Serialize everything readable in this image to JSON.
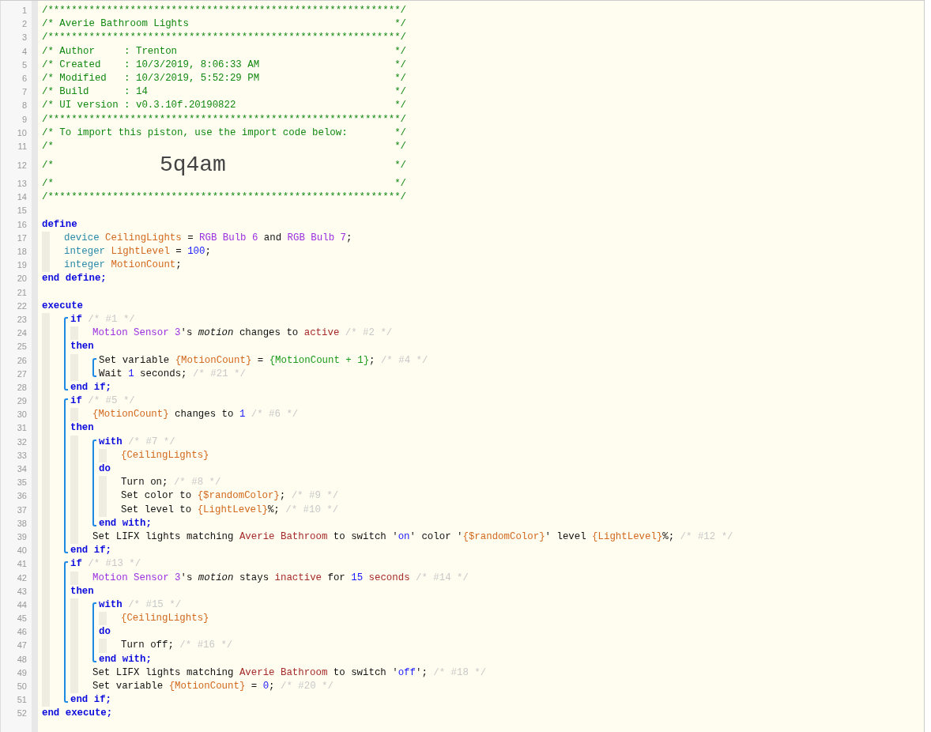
{
  "lines": [
    {
      "kind": "line",
      "number": "1",
      "tokens": [
        {
          "kind": "comment",
          "text": "/************************************************************"
        },
        {
          "kind": "comment_end",
          "text": "/"
        }
      ]
    },
    {
      "kind": "line",
      "number": "2",
      "tokens": [
        {
          "kind": "comment",
          "text": "/* Averie Bathroom Lights"
        },
        {
          "kind": "comment_end",
          "text": "*/"
        }
      ]
    },
    {
      "kind": "line",
      "number": "3",
      "tokens": [
        {
          "kind": "comment",
          "text": "/************************************************************"
        },
        {
          "kind": "comment_end",
          "text": "/"
        }
      ]
    },
    {
      "kind": "line",
      "number": "4",
      "tokens": [
        {
          "kind": "comment",
          "text": "/* Author     : Trenton"
        },
        {
          "kind": "comment_end",
          "text": "*/"
        }
      ]
    },
    {
      "kind": "line",
      "number": "5",
      "tokens": [
        {
          "kind": "comment",
          "text": "/* Created    : 10/3/2019, 8:06:33 AM"
        },
        {
          "kind": "comment_end",
          "text": "*/"
        }
      ]
    },
    {
      "kind": "line",
      "number": "6",
      "tokens": [
        {
          "kind": "comment",
          "text": "/* Modified   : 10/3/2019, 5:52:29 PM"
        },
        {
          "kind": "comment_end",
          "text": "*/"
        }
      ]
    },
    {
      "kind": "line",
      "number": "7",
      "tokens": [
        {
          "kind": "comment",
          "text": "/* Build      : 14"
        },
        {
          "kind": "comment_end",
          "text": "*/"
        }
      ]
    },
    {
      "kind": "line",
      "number": "8",
      "tokens": [
        {
          "kind": "comment",
          "text": "/* UI version : v0.3.10f.20190822"
        },
        {
          "kind": "comment_end",
          "text": "*/"
        }
      ]
    },
    {
      "kind": "line",
      "number": "9",
      "tokens": [
        {
          "kind": "comment",
          "text": "/************************************************************"
        },
        {
          "kind": "comment_end",
          "text": "/"
        }
      ]
    },
    {
      "kind": "line",
      "number": "10",
      "tokens": [
        {
          "kind": "comment",
          "text": "/* To import this piston, use the import code below:"
        },
        {
          "kind": "comment_end",
          "text": "*/"
        }
      ]
    },
    {
      "kind": "line",
      "number": "11",
      "tokens": [
        {
          "kind": "comment",
          "text": "/*"
        },
        {
          "kind": "comment_end",
          "text": "*/"
        }
      ]
    },
    {
      "kind": "line",
      "number": "12",
      "tokens": [
        {
          "kind": "comment",
          "text": "/*"
        },
        {
          "kind": "code",
          "text": "5q4am"
        },
        {
          "kind": "comment_end",
          "text": "*/"
        }
      ]
    },
    {
      "kind": "line",
      "number": "13",
      "tokens": [
        {
          "kind": "comment",
          "text": "/*"
        },
        {
          "kind": "comment_end",
          "text": "*/"
        }
      ]
    },
    {
      "kind": "line",
      "number": "14",
      "tokens": [
        {
          "kind": "comment",
          "text": "/************************************************************"
        },
        {
          "kind": "comment_end",
          "text": "/"
        }
      ]
    },
    {
      "kind": "line",
      "number": "15"
    },
    {
      "kind": "line",
      "number": "16",
      "tokens": [
        {
          "kind": "keyword",
          "text": "define"
        }
      ],
      "children": [
        {
          "kind": "line",
          "number": "17",
          "tokens": [
            {
              "kind": "type",
              "text": "device"
            },
            {
              "kind": "var",
              "text": " CeilingLights"
            },
            {
              "kind": "plain",
              "text": " = "
            },
            {
              "kind": "device",
              "text": "RGB Bulb 6"
            },
            {
              "kind": "plain",
              "text": " and "
            },
            {
              "kind": "device",
              "text": "RGB Bulb 7"
            },
            {
              "kind": "plain",
              "text": ";"
            }
          ]
        },
        {
          "kind": "line",
          "number": "18",
          "tokens": [
            {
              "kind": "type",
              "text": "integer"
            },
            {
              "kind": "var",
              "text": " LightLevel"
            },
            {
              "kind": "plain",
              "text": " = "
            },
            {
              "kind": "number",
              "text": "100"
            },
            {
              "kind": "plain",
              "text": ";"
            }
          ]
        },
        {
          "kind": "line",
          "number": "19",
          "tokens": [
            {
              "kind": "type",
              "text": "integer"
            },
            {
              "kind": "var",
              "text": " MotionCount"
            },
            {
              "kind": "plain",
              "text": ";"
            }
          ]
        }
      ]
    },
    {
      "kind": "line",
      "number": "20",
      "tokens": [
        {
          "kind": "keyword",
          "text": "end define;"
        }
      ]
    },
    {
      "kind": "line",
      "number": "21"
    },
    {
      "kind": "line",
      "number": "22",
      "tokens": [
        {
          "kind": "keyword",
          "text": "execute"
        }
      ],
      "children": [
        {
          "kind": "bracket",
          "items": [
            {
              "kind": "line",
              "number": "23",
              "tokens": [
                {
                  "kind": "keyword",
                  "text": "if"
                },
                {
                  "kind": "note",
                  "text": " /* #1 */"
                }
              ],
              "children": [
                {
                  "kind": "line",
                  "number": "24",
                  "tokens": [
                    {
                      "kind": "device",
                      "text": "Motion Sensor 3"
                    },
                    {
                      "kind": "plain",
                      "text": "'s "
                    },
                    {
                      "kind": "italic",
                      "text": "motion"
                    },
                    {
                      "kind": "plain",
                      "text": " changes to "
                    },
                    {
                      "kind": "value",
                      "text": "active"
                    },
                    {
                      "kind": "note",
                      "text": " /* #2 */"
                    }
                  ]
                }
              ]
            },
            {
              "kind": "line",
              "number": "25",
              "tokens": [
                {
                  "kind": "keyword",
                  "text": "then"
                }
              ],
              "children": [
                {
                  "kind": "bracket",
                  "items": [
                    {
                      "kind": "line",
                      "number": "26",
                      "tokens": [
                        {
                          "kind": "plain",
                          "text": "Set variable "
                        },
                        {
                          "kind": "var",
                          "text": "{MotionCount}"
                        },
                        {
                          "kind": "plain",
                          "text": " = "
                        },
                        {
                          "kind": "expr",
                          "text": "{MotionCount + 1}"
                        },
                        {
                          "kind": "plain",
                          "text": ";"
                        },
                        {
                          "kind": "note",
                          "text": " /* #4 */"
                        }
                      ]
                    },
                    {
                      "kind": "line",
                      "number": "27",
                      "tokens": [
                        {
                          "kind": "plain",
                          "text": "Wait "
                        },
                        {
                          "kind": "number",
                          "text": "1"
                        },
                        {
                          "kind": "plain",
                          "text": " seconds;"
                        },
                        {
                          "kind": "note",
                          "text": " /* #21 */"
                        }
                      ]
                    }
                  ]
                }
              ]
            },
            {
              "kind": "line",
              "number": "28",
              "tokens": [
                {
                  "kind": "keyword",
                  "text": "end if;"
                }
              ]
            }
          ]
        },
        {
          "kind": "bracket",
          "items": [
            {
              "kind": "line",
              "number": "29",
              "tokens": [
                {
                  "kind": "keyword",
                  "text": "if"
                },
                {
                  "kind": "note",
                  "text": " /* #5 */"
                }
              ],
              "children": [
                {
                  "kind": "line",
                  "number": "30",
                  "tokens": [
                    {
                      "kind": "var",
                      "text": "{MotionCount}"
                    },
                    {
                      "kind": "plain",
                      "text": " changes to "
                    },
                    {
                      "kind": "number",
                      "text": "1"
                    },
                    {
                      "kind": "note",
                      "text": " /* #6 */"
                    }
                  ]
                }
              ]
            },
            {
              "kind": "line",
              "number": "31",
              "tokens": [
                {
                  "kind": "keyword",
                  "text": "then"
                }
              ],
              "children": [
                {
                  "kind": "bracket",
                  "items": [
                    {
                      "kind": "line",
                      "number": "32",
                      "tokens": [
                        {
                          "kind": "keyword",
                          "text": "with"
                        },
                        {
                          "kind": "note",
                          "text": " /* #7 */"
                        }
                      ],
                      "children": [
                        {
                          "kind": "line",
                          "number": "33",
                          "tokens": [
                            {
                              "kind": "var",
                              "text": "{CeilingLights}"
                            }
                          ]
                        }
                      ]
                    },
                    {
                      "kind": "line",
                      "number": "34",
                      "tokens": [
                        {
                          "kind": "keyword",
                          "text": "do"
                        }
                      ],
                      "children": [
                        {
                          "kind": "line",
                          "number": "35",
                          "tokens": [
                            {
                              "kind": "plain",
                              "text": "Turn on;"
                            },
                            {
                              "kind": "note",
                              "text": " /* #8 */"
                            }
                          ]
                        },
                        {
                          "kind": "line",
                          "number": "36",
                          "tokens": [
                            {
                              "kind": "plain",
                              "text": "Set color to "
                            },
                            {
                              "kind": "var",
                              "text": "{$randomColor}"
                            },
                            {
                              "kind": "plain",
                              "text": ";"
                            },
                            {
                              "kind": "note",
                              "text": " /* #9 */"
                            }
                          ]
                        },
                        {
                          "kind": "line",
                          "number": "37",
                          "tokens": [
                            {
                              "kind": "plain",
                              "text": "Set level to "
                            },
                            {
                              "kind": "var",
                              "text": "{LightLevel}"
                            },
                            {
                              "kind": "plain",
                              "text": "%;"
                            },
                            {
                              "kind": "note",
                              "text": " /* #10 */"
                            }
                          ]
                        }
                      ]
                    },
                    {
                      "kind": "line",
                      "number": "38",
                      "tokens": [
                        {
                          "kind": "keyword",
                          "text": "end with;"
                        }
                      ]
                    }
                  ]
                },
                {
                  "kind": "line",
                  "number": "39",
                  "tokens": [
                    {
                      "kind": "plain",
                      "text": "Set LIFX lights matching "
                    },
                    {
                      "kind": "value",
                      "text": "Averie Bathroom"
                    },
                    {
                      "kind": "plain",
                      "text": " to switch '"
                    },
                    {
                      "kind": "number",
                      "text": "on"
                    },
                    {
                      "kind": "plain",
                      "text": "' color '"
                    },
                    {
                      "kind": "var",
                      "text": "{$randomColor}"
                    },
                    {
                      "kind": "plain",
                      "text": "' level "
                    },
                    {
                      "kind": "var",
                      "text": "{LightLevel}"
                    },
                    {
                      "kind": "plain",
                      "text": "%;"
                    },
                    {
                      "kind": "note",
                      "text": " /* #12 */"
                    }
                  ]
                }
              ]
            },
            {
              "kind": "line",
              "number": "40",
              "tokens": [
                {
                  "kind": "keyword",
                  "text": "end if;"
                }
              ]
            }
          ]
        },
        {
          "kind": "bracket",
          "items": [
            {
              "kind": "line",
              "number": "41",
              "tokens": [
                {
                  "kind": "keyword",
                  "text": "if"
                },
                {
                  "kind": "note",
                  "text": " /* #13 */"
                }
              ],
              "children": [
                {
                  "kind": "line",
                  "number": "42",
                  "tokens": [
                    {
                      "kind": "device",
                      "text": "Motion Sensor 3"
                    },
                    {
                      "kind": "plain",
                      "text": "'s "
                    },
                    {
                      "kind": "italic",
                      "text": "motion"
                    },
                    {
                      "kind": "plain",
                      "text": " stays "
                    },
                    {
                      "kind": "value",
                      "text": "inactive"
                    },
                    {
                      "kind": "plain",
                      "text": " for "
                    },
                    {
                      "kind": "number",
                      "text": "15"
                    },
                    {
                      "kind": "value",
                      "text": " seconds"
                    },
                    {
                      "kind": "note",
                      "text": " /* #14 */"
                    }
                  ]
                }
              ]
            },
            {
              "kind": "line",
              "number": "43",
              "tokens": [
                {
                  "kind": "keyword",
                  "text": "then"
                }
              ],
              "children": [
                {
                  "kind": "bracket",
                  "items": [
                    {
                      "kind": "line",
                      "number": "44",
                      "tokens": [
                        {
                          "kind": "keyword",
                          "text": "with"
                        },
                        {
                          "kind": "note",
                          "text": " /* #15 */"
                        }
                      ],
                      "children": [
                        {
                          "kind": "line",
                          "number": "45",
                          "tokens": [
                            {
                              "kind": "var",
                              "text": "{CeilingLights}"
                            }
                          ]
                        }
                      ]
                    },
                    {
                      "kind": "line",
                      "number": "46",
                      "tokens": [
                        {
                          "kind": "keyword",
                          "text": "do"
                        }
                      ],
                      "children": [
                        {
                          "kind": "line",
                          "number": "47",
                          "tokens": [
                            {
                              "kind": "plain",
                              "text": "Turn off;"
                            },
                            {
                              "kind": "note",
                              "text": " /* #16 */"
                            }
                          ]
                        }
                      ]
                    },
                    {
                      "kind": "line",
                      "number": "48",
                      "tokens": [
                        {
                          "kind": "keyword",
                          "text": "end with;"
                        }
                      ]
                    }
                  ]
                },
                {
                  "kind": "line",
                  "number": "49",
                  "tokens": [
                    {
                      "kind": "plain",
                      "text": "Set LIFX lights matching "
                    },
                    {
                      "kind": "value",
                      "text": "Averie Bathroom"
                    },
                    {
                      "kind": "plain",
                      "text": " to switch '"
                    },
                    {
                      "kind": "number",
                      "text": "off"
                    },
                    {
                      "kind": "plain",
                      "text": "';"
                    },
                    {
                      "kind": "note",
                      "text": " /* #18 */"
                    }
                  ]
                },
                {
                  "kind": "line",
                  "number": "50",
                  "tokens": [
                    {
                      "kind": "plain",
                      "text": "Set variable "
                    },
                    {
                      "kind": "var",
                      "text": "{MotionCount}"
                    },
                    {
                      "kind": "plain",
                      "text": " = "
                    },
                    {
                      "kind": "number",
                      "text": "0"
                    },
                    {
                      "kind": "plain",
                      "text": ";"
                    },
                    {
                      "kind": "note",
                      "text": " /* #20 */"
                    }
                  ]
                }
              ]
            },
            {
              "kind": "line",
              "number": "51",
              "tokens": [
                {
                  "kind": "keyword",
                  "text": "end if;"
                }
              ]
            }
          ]
        }
      ]
    },
    {
      "kind": "line",
      "number": "52",
      "tokens": [
        {
          "kind": "keyword",
          "text": "end execute;"
        }
      ]
    }
  ]
}
